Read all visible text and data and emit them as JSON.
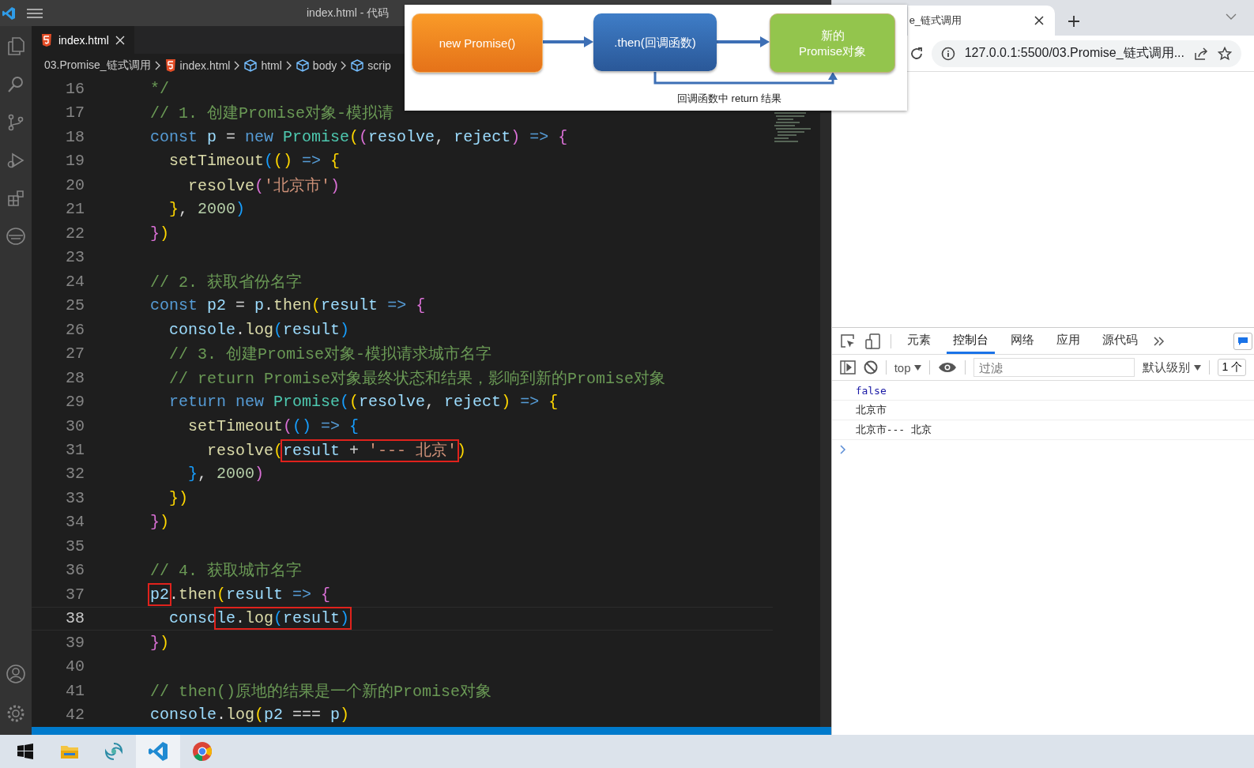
{
  "editor": {
    "title": "index.html - 代码",
    "tab": {
      "label": "index.html",
      "selected": true
    },
    "breadcrumbs": [
      {
        "kind": "folder",
        "label": "03.Promise_链式调用"
      },
      {
        "kind": "file",
        "label": "index.html"
      },
      {
        "kind": "element",
        "label": "html"
      },
      {
        "kind": "element",
        "label": "body"
      },
      {
        "kind": "element",
        "label": "scrip"
      }
    ],
    "lines": [
      {
        "number": "16",
        "current": false,
        "tokens": [
          {
            "kind": "com",
            "text": "*/"
          }
        ]
      },
      {
        "number": "17",
        "current": false,
        "tokens": [
          {
            "kind": "com",
            "text": "// 1. 创建Promise对象-模拟请"
          }
        ]
      },
      {
        "number": "18",
        "current": false,
        "tokens": [
          {
            "kind": "kw",
            "text": "const "
          },
          {
            "kind": "var",
            "text": "p"
          },
          {
            "kind": "op",
            "text": " = "
          },
          {
            "kind": "kw",
            "text": "new "
          },
          {
            "kind": "cls",
            "text": "Promise"
          },
          {
            "kind": "b1",
            "text": "("
          },
          {
            "kind": "b2",
            "text": "("
          },
          {
            "kind": "var",
            "text": "resolve"
          },
          {
            "kind": "op",
            "text": ", "
          },
          {
            "kind": "var",
            "text": "reject"
          },
          {
            "kind": "b2",
            "text": ")"
          },
          {
            "kind": "kw",
            "text": " => "
          },
          {
            "kind": "b2",
            "text": "{"
          }
        ]
      },
      {
        "number": "19",
        "current": false,
        "tokens": [
          {
            "kind": "fn",
            "text": "  setTimeout"
          },
          {
            "kind": "b3",
            "text": "("
          },
          {
            "kind": "b1",
            "text": "()"
          },
          {
            "kind": "kw",
            "text": " => "
          },
          {
            "kind": "b1",
            "text": "{"
          }
        ]
      },
      {
        "number": "20",
        "current": false,
        "tokens": [
          {
            "kind": "fn",
            "text": "    resolve"
          },
          {
            "kind": "b2",
            "text": "("
          },
          {
            "kind": "str",
            "text": "'北京市'"
          },
          {
            "kind": "b2",
            "text": ")"
          }
        ]
      },
      {
        "number": "21",
        "current": false,
        "tokens": [
          {
            "kind": "b1",
            "text": "  }"
          },
          {
            "kind": "op",
            "text": ", "
          },
          {
            "kind": "num",
            "text": "2000"
          },
          {
            "kind": "b3",
            "text": ")"
          }
        ]
      },
      {
        "number": "22",
        "current": false,
        "tokens": [
          {
            "kind": "b2",
            "text": "}"
          },
          {
            "kind": "b1",
            "text": ")"
          }
        ]
      },
      {
        "number": "23",
        "current": false
      },
      {
        "number": "24",
        "current": false,
        "tokens": [
          {
            "kind": "com",
            "text": "// 2. 获取省份名字"
          }
        ]
      },
      {
        "number": "25",
        "current": false,
        "tokens": [
          {
            "kind": "kw",
            "text": "const "
          },
          {
            "kind": "var",
            "text": "p2"
          },
          {
            "kind": "op",
            "text": " = "
          },
          {
            "kind": "var",
            "text": "p"
          },
          {
            "kind": "op",
            "text": "."
          },
          {
            "kind": "fn",
            "text": "then"
          },
          {
            "kind": "b1",
            "text": "("
          },
          {
            "kind": "var",
            "text": "result"
          },
          {
            "kind": "kw",
            "text": " => "
          },
          {
            "kind": "b2",
            "text": "{"
          }
        ]
      },
      {
        "number": "26",
        "current": false,
        "tokens": [
          {
            "kind": "var",
            "text": "  console"
          },
          {
            "kind": "op",
            "text": "."
          },
          {
            "kind": "fn",
            "text": "log"
          },
          {
            "kind": "b3",
            "text": "("
          },
          {
            "kind": "var",
            "text": "result"
          },
          {
            "kind": "b3",
            "text": ")"
          }
        ]
      },
      {
        "number": "27",
        "current": false,
        "tokens": [
          {
            "kind": "com",
            "text": "  // 3. 创建Promise对象-模拟请求城市名字"
          }
        ]
      },
      {
        "number": "28",
        "current": false,
        "tokens": [
          {
            "kind": "com",
            "text": "  // return Promise对象最终状态和结果，影响到新的Promise对象"
          }
        ]
      },
      {
        "number": "29",
        "current": false,
        "tokens": [
          {
            "kind": "kw",
            "text": "  return new "
          },
          {
            "kind": "cls",
            "text": "Promise"
          },
          {
            "kind": "b3",
            "text": "("
          },
          {
            "kind": "b1",
            "text": "("
          },
          {
            "kind": "var",
            "text": "resolve"
          },
          {
            "kind": "op",
            "text": ", "
          },
          {
            "kind": "var",
            "text": "reject"
          },
          {
            "kind": "b1",
            "text": ")"
          },
          {
            "kind": "kw",
            "text": " => "
          },
          {
            "kind": "b1",
            "text": "{"
          }
        ]
      },
      {
        "number": "30",
        "current": false,
        "tokens": [
          {
            "kind": "fn",
            "text": "    setTimeout"
          },
          {
            "kind": "b2",
            "text": "("
          },
          {
            "kind": "b3",
            "text": "()"
          },
          {
            "kind": "kw",
            "text": " => "
          },
          {
            "kind": "b3",
            "text": "{"
          }
        ]
      },
      {
        "number": "31",
        "current": false,
        "tokens": [
          {
            "kind": "fn",
            "text": "      resolve"
          },
          {
            "kind": "b1",
            "text": "("
          },
          {
            "kind": "highlight",
            "tokens": [
              {
                "kind": "var",
                "text": "result"
              },
              {
                "kind": "op",
                "text": " + "
              },
              {
                "kind": "str",
                "text": "'--- 北京'"
              }
            ]
          },
          {
            "kind": "b1",
            "text": ")"
          }
        ]
      },
      {
        "number": "32",
        "current": false,
        "tokens": [
          {
            "kind": "b3",
            "text": "    }"
          },
          {
            "kind": "op",
            "text": ", "
          },
          {
            "kind": "num",
            "text": "2000"
          },
          {
            "kind": "b2",
            "text": ")"
          }
        ]
      },
      {
        "number": "33",
        "current": false,
        "tokens": [
          {
            "kind": "b1",
            "text": "  })"
          }
        ]
      },
      {
        "number": "34",
        "current": false,
        "tokens": [
          {
            "kind": "b2",
            "text": "}"
          },
          {
            "kind": "b1",
            "text": ")"
          }
        ]
      },
      {
        "number": "35",
        "current": false
      },
      {
        "number": "36",
        "current": false,
        "tokens": [
          {
            "kind": "com",
            "text": "// 4. 获取城市名字"
          }
        ]
      },
      {
        "number": "37",
        "current": false,
        "tokens": [
          {
            "kind": "highlight",
            "tokens": [
              {
                "kind": "var",
                "text": "p2"
              }
            ]
          },
          {
            "kind": "op",
            "text": "."
          },
          {
            "kind": "fn",
            "text": "then"
          },
          {
            "kind": "b1",
            "text": "("
          },
          {
            "kind": "var",
            "text": "result"
          },
          {
            "kind": "kw",
            "text": " => "
          },
          {
            "kind": "b2",
            "text": "{"
          }
        ]
      },
      {
        "number": "38",
        "current": true,
        "tokens": [
          {
            "kind": "var",
            "text": "  conso"
          },
          {
            "kind": "highlight",
            "tokens": [
              {
                "kind": "var",
                "text": "le"
              },
              {
                "kind": "op",
                "text": "."
              },
              {
                "kind": "fn",
                "text": "log"
              },
              {
                "kind": "b3",
                "text": "("
              },
              {
                "kind": "var",
                "text": "result"
              },
              {
                "kind": "b3",
                "text": ")"
              }
            ]
          }
        ]
      },
      {
        "number": "39",
        "current": false,
        "tokens": [
          {
            "kind": "b2",
            "text": "}"
          },
          {
            "kind": "b1",
            "text": ")"
          }
        ]
      },
      {
        "number": "40",
        "current": false
      },
      {
        "number": "41",
        "current": false,
        "tokens": [
          {
            "kind": "com",
            "text": "// then()原地的结果是一个新的Promise对象"
          }
        ]
      },
      {
        "number": "42",
        "current": false,
        "tokens": [
          {
            "kind": "var",
            "text": "console"
          },
          {
            "kind": "op",
            "text": "."
          },
          {
            "kind": "fn",
            "text": "log"
          },
          {
            "kind": "b1",
            "text": "("
          },
          {
            "kind": "var",
            "text": "p2"
          },
          {
            "kind": "op",
            "text": " === "
          },
          {
            "kind": "var",
            "text": "p"
          },
          {
            "kind": "b1",
            "text": ")"
          }
        ]
      }
    ]
  },
  "diagram": {
    "nodes": [
      {
        "kind": "start",
        "lines": [
          "new Promise()"
        ]
      },
      {
        "kind": "then",
        "lines": [
          ".then(回调函数)"
        ]
      },
      {
        "kind": "result",
        "lines": [
          "新的",
          "Promise对象"
        ]
      }
    ],
    "loop_label": "回调函数中 return 结果"
  },
  "browser": {
    "tab": {
      "title": "e_链式调用",
      "selected": true
    },
    "url": "127.0.0.1:5500/03.Promise_链式调用...",
    "devtools": {
      "tabs": [
        {
          "label": "元素",
          "selected": false
        },
        {
          "label": "控制台",
          "selected": true
        },
        {
          "label": "网络",
          "selected": false
        },
        {
          "label": "应用",
          "selected": false
        },
        {
          "label": "源代码",
          "selected": false
        }
      ],
      "context": "top",
      "filter": {
        "placeholder": "过滤"
      },
      "level": "默认级别",
      "issues": "1 个",
      "messages": [
        {
          "kind": "boolean",
          "text": "false"
        },
        {
          "kind": "string",
          "text": "北京市"
        },
        {
          "kind": "string",
          "text": "北京市--- 北京"
        }
      ]
    }
  }
}
